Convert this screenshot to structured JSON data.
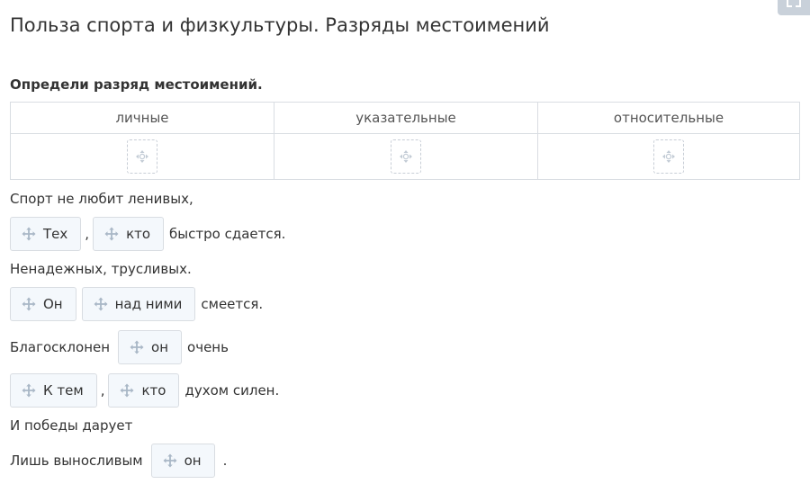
{
  "app": {
    "title": "Польза спорта и физкультуры. Разряды местоимений",
    "instruction": "Определи разряд местоимений."
  },
  "categories": [
    "личные",
    "указательные",
    "относительные"
  ],
  "lines": {
    "l1": {
      "text": "Спорт не любит ленивых,"
    },
    "l2": {
      "chip_a": "Тех",
      "sep": ",",
      "chip_b": "кто",
      "after": "быстро сдается."
    },
    "l3": {
      "text": "Ненадежных, трусливых."
    },
    "l4": {
      "chip_a": "Он",
      "chip_b": "над ними",
      "after": "смеется."
    },
    "l5": {
      "before": "Благосклонен",
      "chip_a": "он",
      "after": "очень"
    },
    "l6": {
      "chip_a": "К тем",
      "sep": ",",
      "chip_b": "кто",
      "after": "духом силен."
    },
    "l7": {
      "text": "И победы дарует"
    },
    "l8": {
      "before": "Лишь выносливым",
      "chip_a": "он",
      "after": "."
    }
  },
  "colors": {
    "chip_bg": "#f4f8fc",
    "chip_border": "#d9dde2",
    "icon": "#a9b7c6",
    "text": "#333333"
  },
  "icons": {
    "drag_handle": "move-icon",
    "drop_target": "move-icon",
    "corner": "expand-icon"
  }
}
